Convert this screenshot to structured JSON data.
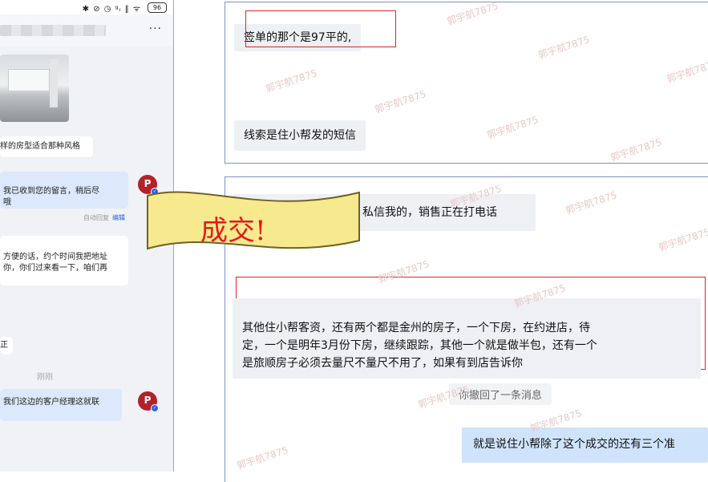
{
  "status_bar": {
    "icons": "✱ ⊘ ◷ ᵍᵢ ‖ ᯤ",
    "battery": "96"
  },
  "nav": {
    "more": "···"
  },
  "phone_chat": {
    "msg1": "样的房型适合那种风格",
    "msg2": " 我已收到您的留言，稍后尽\n哦",
    "auto_reply": "自动回复",
    "edit": "编辑",
    "msg3": "方便的话，约个时间我把地址\n你，你们过来看一下，咱们再",
    "msg4": "正",
    "time_divider": "刚刚",
    "msg5": " 我们这边的客户经理这就联",
    "avatar_glyph": "P"
  },
  "top_panel": {
    "msg1": "签单的那个是97平的,",
    "msg2": "线索是住小帮发的短信"
  },
  "bottom_panel": {
    "msg1": "私信我的，销售正在打电话",
    "msg2": "其他住小帮客资，还有两个都是金州的房子，一个下房，在约进店，待\n定，一个是明年3月份下房，继续跟踪，其他一个就是做半包，还有一个\n是旅顺房子必须去量尺不量尺不用了，如果有到店告诉你",
    "system": "你撤回了一条消息",
    "msg3": "就是说住小帮除了这个成交的还有三个",
    "msg3_cut": "准"
  },
  "banner": {
    "text": "成交!",
    "fill": "#f7e98e",
    "stroke": "#6f6224"
  },
  "watermark": "郭宇航7875",
  "colors": {
    "red_box": "#d9262c",
    "mine_bubble": "#cfe4fb",
    "panel_border": "#7e93c4"
  }
}
